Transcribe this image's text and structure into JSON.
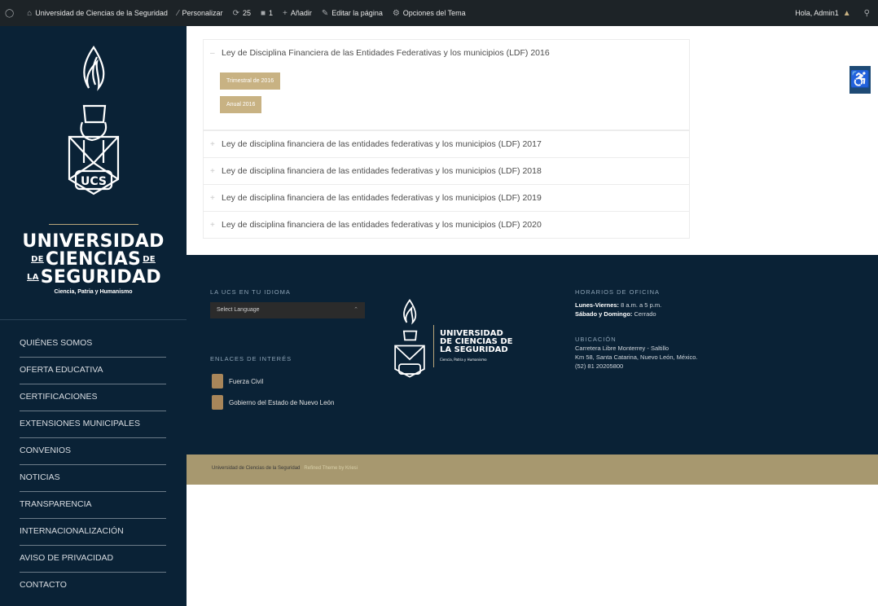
{
  "admin_bar": {
    "site_name": "Universidad de Ciencias de la Seguridad",
    "customize": "Personalizar",
    "updates_count": "25",
    "comments_count": "1",
    "add_new": "Añadir",
    "edit_page": "Editar la página",
    "theme_options": "Opciones del Tema",
    "greeting": "Hola, Admin1"
  },
  "sidebar": {
    "logo_mark_text": "UCS",
    "university_line1": "UNIVERSIDAD",
    "university_line2_prefix": "DE",
    "university_line2_main": "CIENCIAS",
    "university_line2_suffix": "DE",
    "university_line3_prefix": "LA",
    "university_line3_main": "SEGURIDAD",
    "tagline": "Ciencia, Patria y Humanismo",
    "menu": [
      {
        "label": "QUIÉNES SOMOS"
      },
      {
        "label": "OFERTA EDUCATIVA"
      },
      {
        "label": "CERTIFICACIONES"
      },
      {
        "label": "EXTENSIONES MUNICIPALES"
      },
      {
        "label": "CONVENIOS"
      },
      {
        "label": "NOTICIAS"
      },
      {
        "label": "TRANSPARENCIA"
      },
      {
        "label": "INTERNACIONALIZACIÓN"
      },
      {
        "label": "AVISO DE PRIVACIDAD"
      },
      {
        "label": "CONTACTO"
      }
    ]
  },
  "accordion": {
    "open_item": {
      "title": "Ley de Disciplina Financiera de las Entidades Federativas y los municipios (LDF) 2016",
      "buttons": [
        "Trimestral de 2016",
        "Anual 2016"
      ]
    },
    "items": [
      {
        "title": "Ley de disciplina financiera de las entidades federativas y los municipios (LDF) 2017"
      },
      {
        "title": "Ley de disciplina financiera de las entidades federativas y los municipios (LDF) 2018"
      },
      {
        "title": "Ley de disciplina financiera de las entidades federativas y los municipios (LDF) 2019"
      },
      {
        "title": "Ley de disciplina financiera de las entidades federativas y los municipios (LDF) 2020"
      }
    ]
  },
  "footer": {
    "lang_heading": "LA UCS EN TU IDIOMA",
    "lang_select": "Select Language",
    "links_heading": "ENLACES DE INTERÉS",
    "links": [
      {
        "label": "Fuerza Civil"
      },
      {
        "label": "Gobierno del Estado de Nuevo León"
      }
    ],
    "logo_line1": "UNIVERSIDAD",
    "logo_line2": "DE CIENCIAS DE",
    "logo_line3": "LA SEGURIDAD",
    "logo_tagline": "Ciencia, Patria y Humanismo",
    "hours_heading": "HORARIOS DE OFICINA",
    "weekdays_label": "Lunes-Viernes:",
    "weekdays_value": " 8 a.m. a 5 p.m.",
    "weekend_label": "Sábado y Domingo:",
    "weekend_value": " Cerrado",
    "location_heading": "UBICACIÓN",
    "address1": "Carretera Libre Monterrey - Saltillo",
    "address2": "Km 58, Santa Catarina, Nuevo León, México.",
    "phone": "(52) 81 20205800"
  },
  "bottom_bar": {
    "copyright": "Universidad de Ciencias de la Seguridad",
    "theme_credit": "Refined Theme by Kriesi"
  },
  "colors": {
    "navy": "#0a2236",
    "gold": "#c8b283",
    "gold_bar": "#a7986f",
    "admin_bar": "#1d2327"
  },
  "icons": {
    "wp_logo": "wordpress-icon",
    "home": "home-icon",
    "customize": "brush-icon",
    "updates": "refresh-icon",
    "comments": "comment-icon",
    "add": "plus-icon",
    "edit": "pencil-icon",
    "accessibility": "accessibility-icon"
  }
}
